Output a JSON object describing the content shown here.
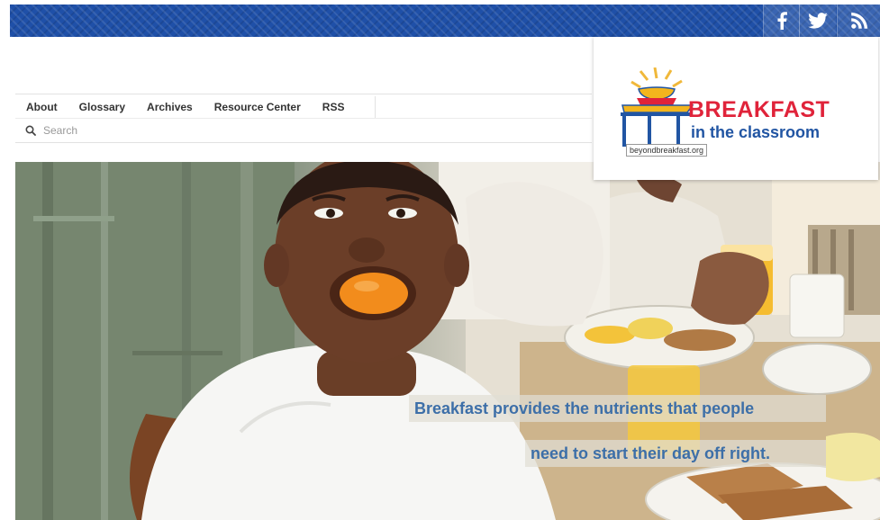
{
  "social": {
    "facebook": "facebook-icon",
    "twitter": "twitter-icon",
    "rss": "rss-icon"
  },
  "nav": {
    "items": [
      {
        "label": "About"
      },
      {
        "label": "Glossary"
      },
      {
        "label": "Archives"
      },
      {
        "label": "Resource Center"
      },
      {
        "label": "RSS"
      }
    ]
  },
  "search": {
    "placeholder": "Search"
  },
  "logo": {
    "brand_line1": "BREAKFAST",
    "brand_line2": "in the classroom",
    "url": "beyondbreakfast.org"
  },
  "hero": {
    "caption_line1": "Breakfast provides the nutrients that people",
    "caption_line2": "need to start their day off right."
  },
  "colors": {
    "topbar": "#1f50a8",
    "brand_red": "#e0233a",
    "brand_blue": "#2155a3",
    "caption_text": "#3d6fa8"
  }
}
